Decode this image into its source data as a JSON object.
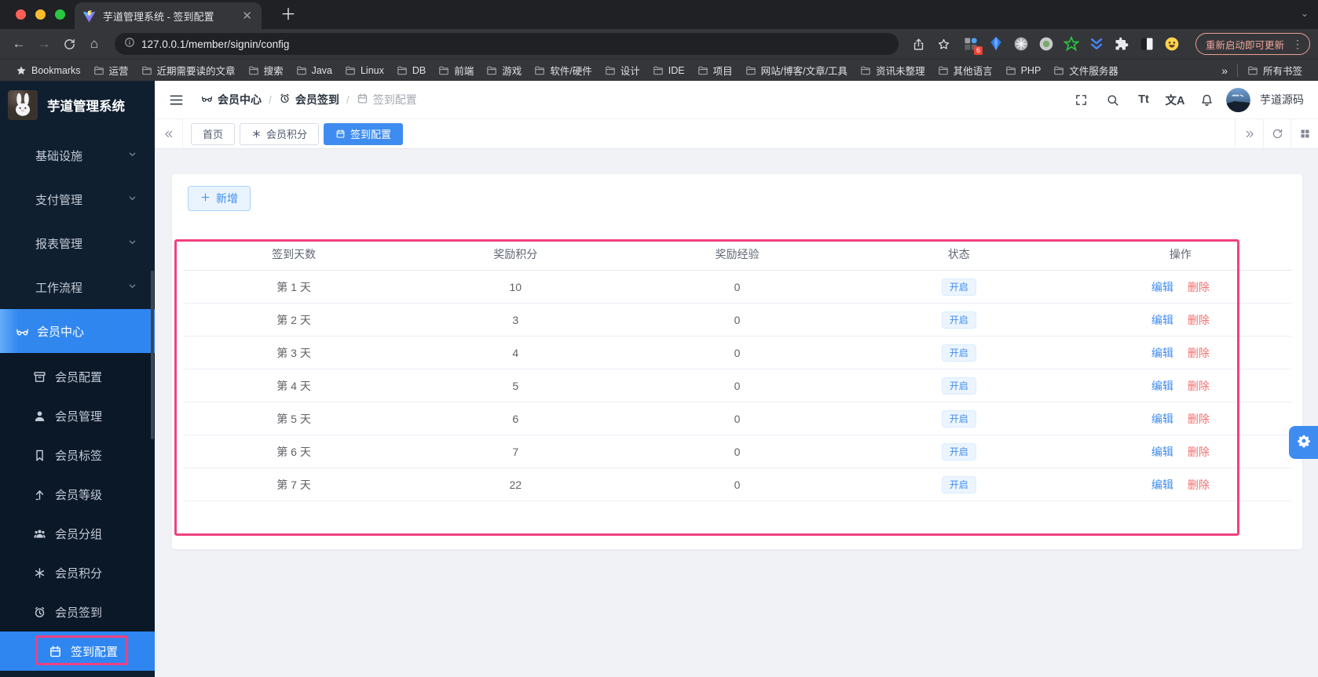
{
  "browser": {
    "tab_title": "芋道管理系统 - 签到配置",
    "url": "127.0.0.1/member/signin/config",
    "update_button": "重新启动即可更新",
    "extension_badge": "6",
    "extensions": [
      "grid-badge",
      "kite",
      "snowflake",
      "record",
      "star-green",
      "chevrons",
      "puzzle",
      "contrast",
      "emoji"
    ],
    "bookmarks_star_label": "Bookmarks",
    "bookmark_folders": [
      "运营",
      "近期需要读的文章",
      "搜索",
      "Java",
      "Linux",
      "DB",
      "前端",
      "游戏",
      "软件/硬件",
      "设计",
      "IDE",
      "项目",
      "网站/博客/文章/工具",
      "资讯未整理",
      "其他语言",
      "PHP",
      "文件服务器"
    ],
    "bookmarks_overflow": "»",
    "all_bookmarks_label": "所有书签"
  },
  "sidebar": {
    "title": "芋道管理系统",
    "sections": [
      "基础设施",
      "支付管理",
      "报表管理",
      "工作流程"
    ],
    "member_center": {
      "label": "会员中心",
      "icon": "glasses"
    },
    "submenu": [
      {
        "label": "会员配置",
        "icon": "archive"
      },
      {
        "label": "会员管理",
        "icon": "user"
      },
      {
        "label": "会员标签",
        "icon": "bookmark"
      },
      {
        "label": "会员等级",
        "icon": "level"
      },
      {
        "label": "会员分组",
        "icon": "group"
      },
      {
        "label": "会员积分",
        "icon": "asterisk"
      }
    ],
    "signin_group": {
      "label": "会员签到",
      "icon": "alarm"
    },
    "active_item": {
      "label": "签到配置",
      "icon": "calendar"
    }
  },
  "navbar": {
    "breadcrumb": [
      {
        "label": "会员中心",
        "icon": "glasses"
      },
      {
        "label": "会员签到",
        "icon": "alarm"
      },
      {
        "label": "签到配置",
        "icon": "calendar"
      }
    ],
    "font_size_button": "Tt",
    "language_button": "文A",
    "username": "芋道源码"
  },
  "tabbar": {
    "tabs": [
      {
        "label": "首页",
        "icon": null,
        "active": false
      },
      {
        "label": "会员积分",
        "icon": "asterisk",
        "active": false
      },
      {
        "label": "签到配置",
        "icon": "calendar",
        "active": true
      }
    ]
  },
  "toolbar": {
    "add_label": "新增"
  },
  "table": {
    "columns": [
      "签到天数",
      "奖励积分",
      "奖励经验",
      "状态",
      "操作"
    ],
    "actions": {
      "edit": "编辑",
      "delete": "删除"
    },
    "rows": [
      {
        "day": "第 1 天",
        "points": "10",
        "exp": "0",
        "status": "开启"
      },
      {
        "day": "第 2 天",
        "points": "3",
        "exp": "0",
        "status": "开启"
      },
      {
        "day": "第 3 天",
        "points": "4",
        "exp": "0",
        "status": "开启"
      },
      {
        "day": "第 4 天",
        "points": "5",
        "exp": "0",
        "status": "开启"
      },
      {
        "day": "第 5 天",
        "points": "6",
        "exp": "0",
        "status": "开启"
      },
      {
        "day": "第 6 天",
        "points": "7",
        "exp": "0",
        "status": "开启"
      },
      {
        "day": "第 7 天",
        "points": "22",
        "exp": "0",
        "status": "开启"
      }
    ]
  },
  "colors": {
    "accent": "#3f8cf0",
    "danger": "#f56c6c",
    "annotation": "#f0417f",
    "status_badge_bg": "#ecf5ff",
    "sidebar_bg": "#101f30",
    "submenu_bg": "#0b1828",
    "chrome_dark": "#202124",
    "chrome_toolbar": "#35363a",
    "update_pill": "#eda79a"
  }
}
